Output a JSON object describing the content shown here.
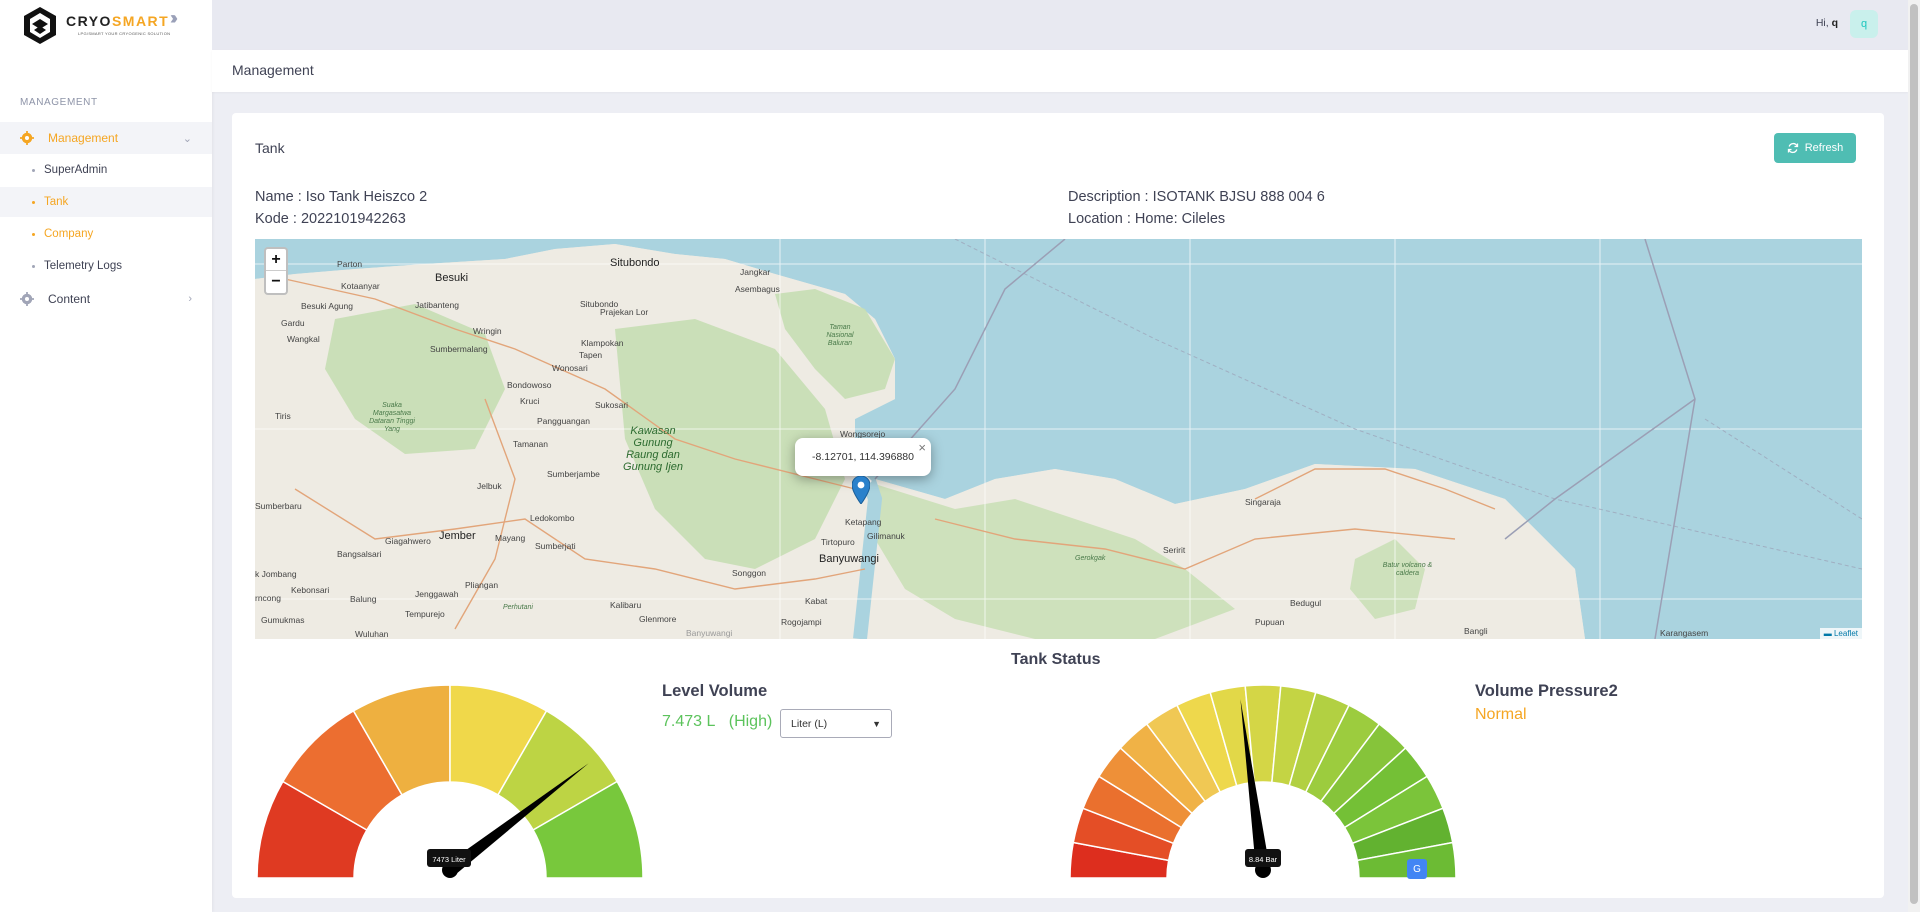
{
  "brand": {
    "name_part1": "CRYO",
    "name_part2": "SMART",
    "tagline": "LPG/SMART YOUR CRYOGENIC SOLUTION"
  },
  "sidebar": {
    "section_label": "MANAGEMENT",
    "groups": [
      {
        "label": "Management",
        "icon": "gear-icon",
        "expanded": true
      },
      {
        "label": "Content",
        "icon": "gear-icon",
        "expanded": false
      }
    ],
    "submenu": [
      {
        "label": "SuperAdmin"
      },
      {
        "label": "Tank"
      },
      {
        "label": "Company"
      },
      {
        "label": "Telemetry Logs"
      }
    ]
  },
  "topbar": {
    "greeting": "Hi,",
    "user": "q",
    "avatar": "q"
  },
  "subheader": {
    "title": "Management"
  },
  "card": {
    "title": "Tank",
    "refresh_label": "Refresh",
    "name": "Name : Iso Tank Heiszco 2",
    "kode": "Kode : 2022101942263",
    "description": "Description : ISOTANK BJSU 888 004 6",
    "location": "Location : Home: Cileles"
  },
  "map": {
    "popup_coords": "-8.12701, 114.396880",
    "zoom_in": "+",
    "zoom_out": "−",
    "attribution": "Leaflet",
    "labels": {
      "parton": "Parton",
      "kotaanyar": "Kotaanyar",
      "besuki": "Besuki",
      "situbondo": "Situbondo",
      "jangkar": "Jangkar",
      "asembagus": "Asembagus",
      "besuki_agung": "Besuki Agung",
      "jatibanteng": "Jatibanteng",
      "prajekan_lor": "Prajekan Lor",
      "gardu": "Gardu",
      "wangkal": "Wangkal",
      "wringin": "Wringin",
      "klampokan": "Klampokan",
      "tapen": "Tapen",
      "sumbermalang": "Sumbermalang",
      "wonosari": "Wonosari",
      "situbondo_grey": "Situbondo",
      "baluran": "Taman Nasional Baluran",
      "bondowoso": "Bondowoso",
      "kruci": "Kruci",
      "sukosari": "Sukosari",
      "argopuro": "Suaka Margasatwa Dataran Tinggi Yang",
      "pangguangan": "Pangguangan",
      "wongsorejo": "Wongsorejo",
      "tiris": "Tiris",
      "tamanan": "Tamanan",
      "ijen": "Kawasan Gunung Raung dan Gunung Ijen",
      "sumberjambe": "Sumberjambe",
      "jelbuk": "Jelbuk",
      "singaraja": "Singaraja",
      "sumberbaru": "Sumberbaru",
      "ledokombo": "Ledokombo",
      "ketapang": "Ketapang",
      "gilimanuk": "Gilimanuk",
      "jember": "Jember",
      "mayang": "Mayang",
      "giagahwero": "Giagahwero",
      "tirtopuro": "Tirtopuro",
      "seririt": "Seririt",
      "bangsalsari": "Bangsalsari",
      "sumberjati": "Sumberjati",
      "banyuwangi": "Banyuwangi",
      "gerokgak": "Gerokgak",
      "batur": "Batur volcano & caldera",
      "kjombang": "k Jombang",
      "pliangan": "Pliangan",
      "songgon": "Songgon",
      "kebonsari": "Kebonsari",
      "jenggawah": "Jenggawah",
      "kabat": "Kabat",
      "bedugul": "Bedugul",
      "rncong": "rncong",
      "balung": "Balung",
      "kalibaru": "Kalibaru",
      "perhutani": "Perhutani",
      "gumukmas": "Gumukmas",
      "tempurejo": "Tempurejo",
      "glenmore": "Glenmore",
      "rogojampi": "Rogojampi",
      "pupuan": "Pupuan",
      "bangli": "Bangli",
      "wuluhan": "Wuluhan",
      "banyuwangi_grey": "Banyuwangi",
      "karangasem": "Karangasem"
    }
  },
  "tank_status": {
    "title": "Tank Status",
    "level": {
      "label": "Level Volume",
      "value": "7.473 L",
      "status": "(High)",
      "gauge_text": "7473 Liter",
      "fraction": 0.78,
      "unit_select": "Liter (L)"
    },
    "pressure": {
      "label": "Volume Pressure2",
      "status": "Normal",
      "gauge_text": "8.84 Bar",
      "fraction": 0.46
    }
  },
  "colors": {
    "accent": "#f5a623",
    "teal": "#4fbdb3",
    "good": "#5cc35c"
  }
}
